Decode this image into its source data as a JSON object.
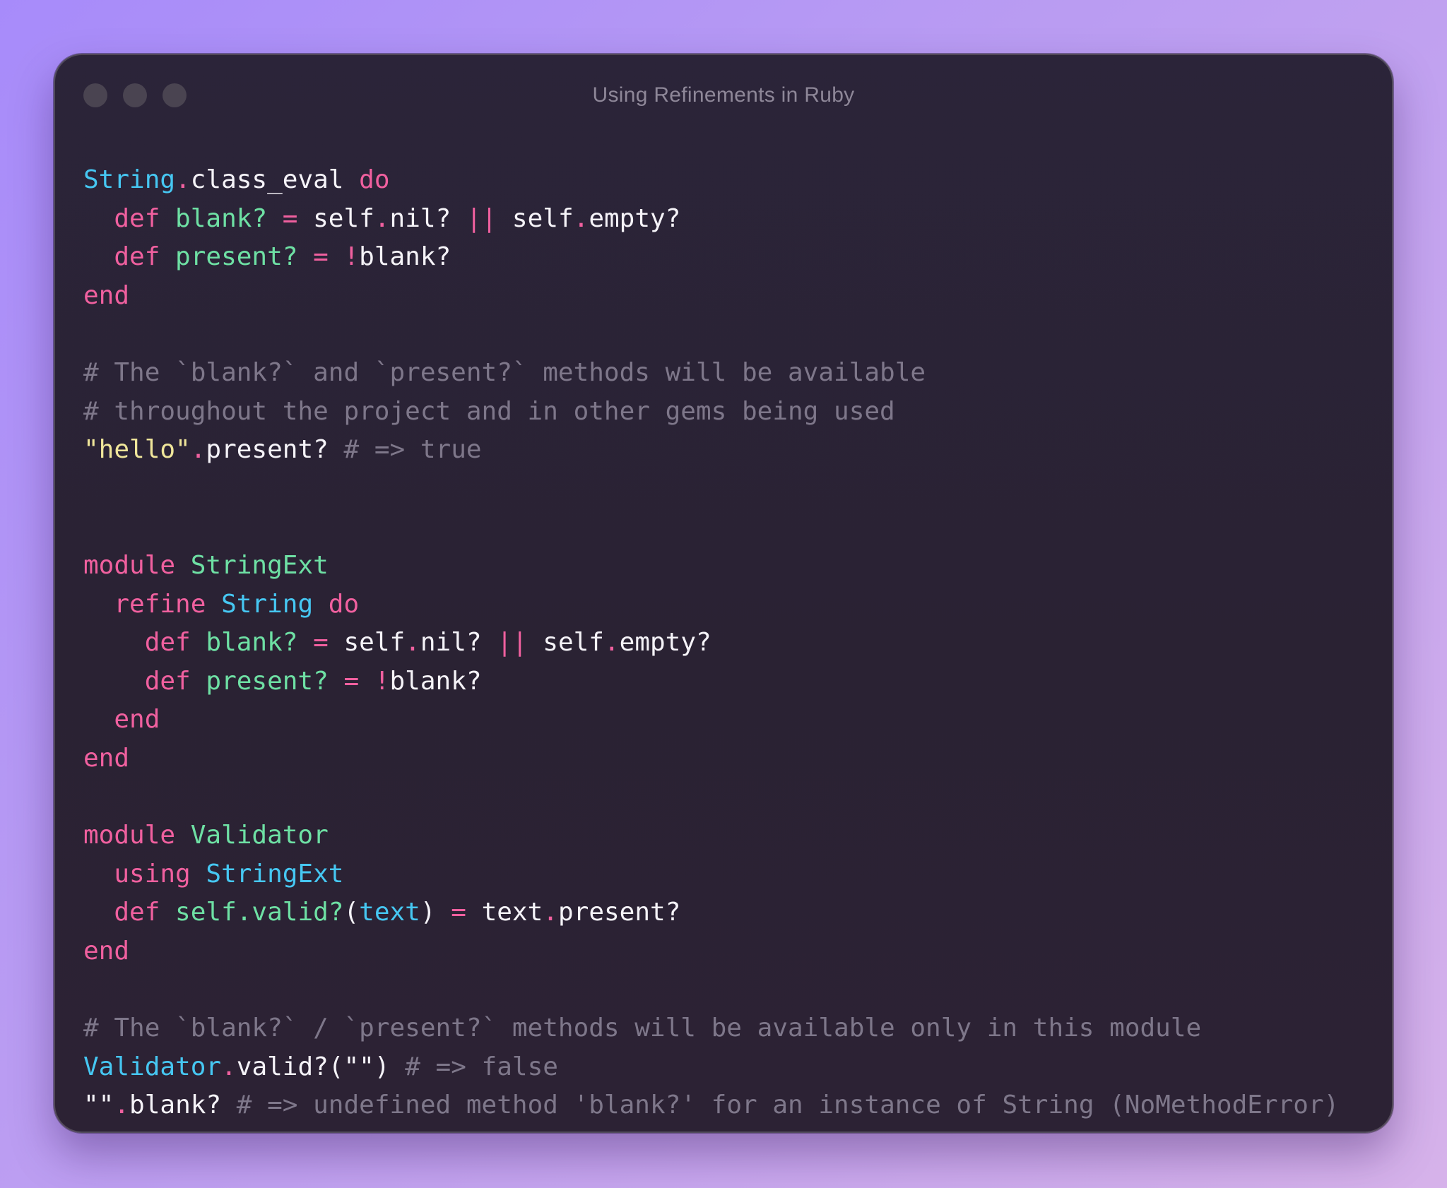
{
  "window": {
    "title": "Using Refinements in Ruby"
  },
  "colors": {
    "keyword": "#f0609f",
    "constant": "#46c7f2",
    "function": "#6ee0a4",
    "string": "#efe59a",
    "comment": "#7e778a",
    "text": "#f5f3f8",
    "window_bg": "#2b2439"
  },
  "code": {
    "lines": [
      [
        {
          "t": "String",
          "c": "const"
        },
        {
          "t": ".",
          "c": "op"
        },
        {
          "t": "class_eval ",
          "c": "id"
        },
        {
          "t": "do",
          "c": "kw"
        }
      ],
      [
        {
          "t": "  def ",
          "c": "kw"
        },
        {
          "t": "blank? ",
          "c": "fn"
        },
        {
          "t": "= ",
          "c": "op"
        },
        {
          "t": "self",
          "c": "id"
        },
        {
          "t": ".",
          "c": "op"
        },
        {
          "t": "nil? ",
          "c": "id"
        },
        {
          "t": "|| ",
          "c": "op"
        },
        {
          "t": "self",
          "c": "id"
        },
        {
          "t": ".",
          "c": "op"
        },
        {
          "t": "empty?",
          "c": "id"
        }
      ],
      [
        {
          "t": "  def ",
          "c": "kw"
        },
        {
          "t": "present? ",
          "c": "fn"
        },
        {
          "t": "= !",
          "c": "op"
        },
        {
          "t": "blank?",
          "c": "id"
        }
      ],
      [
        {
          "t": "end",
          "c": "kw"
        }
      ],
      [],
      [
        {
          "t": "# The `blank?` and `present?` methods will be available",
          "c": "cm"
        }
      ],
      [
        {
          "t": "# throughout the project and in other gems being used",
          "c": "cm"
        }
      ],
      [
        {
          "t": "\"hello\"",
          "c": "str"
        },
        {
          "t": ".",
          "c": "op"
        },
        {
          "t": "present? ",
          "c": "id"
        },
        {
          "t": "# => true",
          "c": "cm"
        }
      ],
      [],
      [],
      [
        {
          "t": "module ",
          "c": "kw"
        },
        {
          "t": "StringExt",
          "c": "fn"
        }
      ],
      [
        {
          "t": "  refine ",
          "c": "kw"
        },
        {
          "t": "String ",
          "c": "const"
        },
        {
          "t": "do",
          "c": "kw"
        }
      ],
      [
        {
          "t": "    def ",
          "c": "kw"
        },
        {
          "t": "blank? ",
          "c": "fn"
        },
        {
          "t": "= ",
          "c": "op"
        },
        {
          "t": "self",
          "c": "id"
        },
        {
          "t": ".",
          "c": "op"
        },
        {
          "t": "nil? ",
          "c": "id"
        },
        {
          "t": "|| ",
          "c": "op"
        },
        {
          "t": "self",
          "c": "id"
        },
        {
          "t": ".",
          "c": "op"
        },
        {
          "t": "empty?",
          "c": "id"
        }
      ],
      [
        {
          "t": "    def ",
          "c": "kw"
        },
        {
          "t": "present? ",
          "c": "fn"
        },
        {
          "t": "= !",
          "c": "op"
        },
        {
          "t": "blank?",
          "c": "id"
        }
      ],
      [
        {
          "t": "  end",
          "c": "kw"
        }
      ],
      [
        {
          "t": "end",
          "c": "kw"
        }
      ],
      [],
      [
        {
          "t": "module ",
          "c": "kw"
        },
        {
          "t": "Validator",
          "c": "fn"
        }
      ],
      [
        {
          "t": "  using ",
          "c": "kw"
        },
        {
          "t": "StringExt",
          "c": "const"
        }
      ],
      [
        {
          "t": "  def ",
          "c": "kw"
        },
        {
          "t": "self.valid?",
          "c": "fn"
        },
        {
          "t": "(",
          "c": "id"
        },
        {
          "t": "text",
          "c": "const"
        },
        {
          "t": ") ",
          "c": "id"
        },
        {
          "t": "= ",
          "c": "op"
        },
        {
          "t": "text",
          "c": "id"
        },
        {
          "t": ".",
          "c": "op"
        },
        {
          "t": "present?",
          "c": "id"
        }
      ],
      [
        {
          "t": "end",
          "c": "kw"
        }
      ],
      [],
      [
        {
          "t": "# The `blank?` / `present?` methods will be available only in this module",
          "c": "cm"
        }
      ],
      [
        {
          "t": "Validator",
          "c": "const"
        },
        {
          "t": ".",
          "c": "op"
        },
        {
          "t": "valid?(\"\") ",
          "c": "id"
        },
        {
          "t": "# => false",
          "c": "cm"
        }
      ],
      [
        {
          "t": "\"\"",
          "c": "id"
        },
        {
          "t": ".",
          "c": "op"
        },
        {
          "t": "blank? ",
          "c": "id"
        },
        {
          "t": "# => undefined method 'blank?' for an instance of String (NoMethodError)",
          "c": "cm"
        }
      ]
    ]
  }
}
